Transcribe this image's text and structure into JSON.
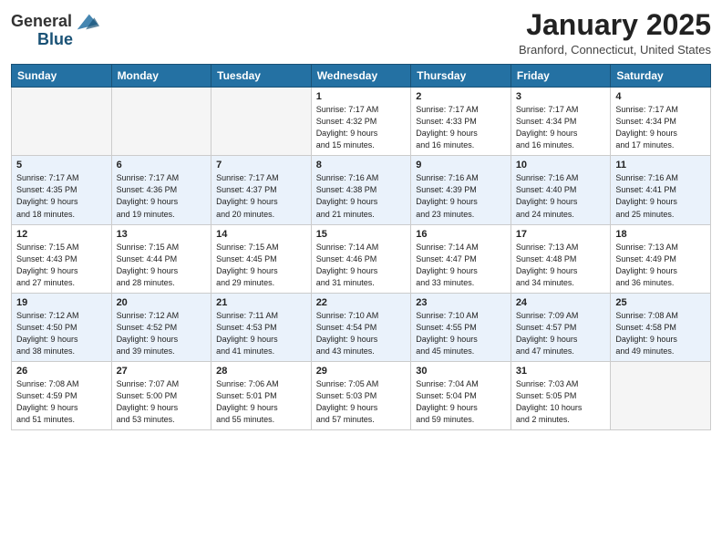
{
  "header": {
    "logo_general": "General",
    "logo_blue": "Blue",
    "month": "January 2025",
    "location": "Branford, Connecticut, United States"
  },
  "days_of_week": [
    "Sunday",
    "Monday",
    "Tuesday",
    "Wednesday",
    "Thursday",
    "Friday",
    "Saturday"
  ],
  "weeks": [
    {
      "days": [
        {
          "num": "",
          "info": ""
        },
        {
          "num": "",
          "info": ""
        },
        {
          "num": "",
          "info": ""
        },
        {
          "num": "1",
          "info": "Sunrise: 7:17 AM\nSunset: 4:32 PM\nDaylight: 9 hours\nand 15 minutes."
        },
        {
          "num": "2",
          "info": "Sunrise: 7:17 AM\nSunset: 4:33 PM\nDaylight: 9 hours\nand 16 minutes."
        },
        {
          "num": "3",
          "info": "Sunrise: 7:17 AM\nSunset: 4:34 PM\nDaylight: 9 hours\nand 16 minutes."
        },
        {
          "num": "4",
          "info": "Sunrise: 7:17 AM\nSunset: 4:34 PM\nDaylight: 9 hours\nand 17 minutes."
        }
      ]
    },
    {
      "days": [
        {
          "num": "5",
          "info": "Sunrise: 7:17 AM\nSunset: 4:35 PM\nDaylight: 9 hours\nand 18 minutes."
        },
        {
          "num": "6",
          "info": "Sunrise: 7:17 AM\nSunset: 4:36 PM\nDaylight: 9 hours\nand 19 minutes."
        },
        {
          "num": "7",
          "info": "Sunrise: 7:17 AM\nSunset: 4:37 PM\nDaylight: 9 hours\nand 20 minutes."
        },
        {
          "num": "8",
          "info": "Sunrise: 7:16 AM\nSunset: 4:38 PM\nDaylight: 9 hours\nand 21 minutes."
        },
        {
          "num": "9",
          "info": "Sunrise: 7:16 AM\nSunset: 4:39 PM\nDaylight: 9 hours\nand 23 minutes."
        },
        {
          "num": "10",
          "info": "Sunrise: 7:16 AM\nSunset: 4:40 PM\nDaylight: 9 hours\nand 24 minutes."
        },
        {
          "num": "11",
          "info": "Sunrise: 7:16 AM\nSunset: 4:41 PM\nDaylight: 9 hours\nand 25 minutes."
        }
      ]
    },
    {
      "days": [
        {
          "num": "12",
          "info": "Sunrise: 7:15 AM\nSunset: 4:43 PM\nDaylight: 9 hours\nand 27 minutes."
        },
        {
          "num": "13",
          "info": "Sunrise: 7:15 AM\nSunset: 4:44 PM\nDaylight: 9 hours\nand 28 minutes."
        },
        {
          "num": "14",
          "info": "Sunrise: 7:15 AM\nSunset: 4:45 PM\nDaylight: 9 hours\nand 29 minutes."
        },
        {
          "num": "15",
          "info": "Sunrise: 7:14 AM\nSunset: 4:46 PM\nDaylight: 9 hours\nand 31 minutes."
        },
        {
          "num": "16",
          "info": "Sunrise: 7:14 AM\nSunset: 4:47 PM\nDaylight: 9 hours\nand 33 minutes."
        },
        {
          "num": "17",
          "info": "Sunrise: 7:13 AM\nSunset: 4:48 PM\nDaylight: 9 hours\nand 34 minutes."
        },
        {
          "num": "18",
          "info": "Sunrise: 7:13 AM\nSunset: 4:49 PM\nDaylight: 9 hours\nand 36 minutes."
        }
      ]
    },
    {
      "days": [
        {
          "num": "19",
          "info": "Sunrise: 7:12 AM\nSunset: 4:50 PM\nDaylight: 9 hours\nand 38 minutes."
        },
        {
          "num": "20",
          "info": "Sunrise: 7:12 AM\nSunset: 4:52 PM\nDaylight: 9 hours\nand 39 minutes."
        },
        {
          "num": "21",
          "info": "Sunrise: 7:11 AM\nSunset: 4:53 PM\nDaylight: 9 hours\nand 41 minutes."
        },
        {
          "num": "22",
          "info": "Sunrise: 7:10 AM\nSunset: 4:54 PM\nDaylight: 9 hours\nand 43 minutes."
        },
        {
          "num": "23",
          "info": "Sunrise: 7:10 AM\nSunset: 4:55 PM\nDaylight: 9 hours\nand 45 minutes."
        },
        {
          "num": "24",
          "info": "Sunrise: 7:09 AM\nSunset: 4:57 PM\nDaylight: 9 hours\nand 47 minutes."
        },
        {
          "num": "25",
          "info": "Sunrise: 7:08 AM\nSunset: 4:58 PM\nDaylight: 9 hours\nand 49 minutes."
        }
      ]
    },
    {
      "days": [
        {
          "num": "26",
          "info": "Sunrise: 7:08 AM\nSunset: 4:59 PM\nDaylight: 9 hours\nand 51 minutes."
        },
        {
          "num": "27",
          "info": "Sunrise: 7:07 AM\nSunset: 5:00 PM\nDaylight: 9 hours\nand 53 minutes."
        },
        {
          "num": "28",
          "info": "Sunrise: 7:06 AM\nSunset: 5:01 PM\nDaylight: 9 hours\nand 55 minutes."
        },
        {
          "num": "29",
          "info": "Sunrise: 7:05 AM\nSunset: 5:03 PM\nDaylight: 9 hours\nand 57 minutes."
        },
        {
          "num": "30",
          "info": "Sunrise: 7:04 AM\nSunset: 5:04 PM\nDaylight: 9 hours\nand 59 minutes."
        },
        {
          "num": "31",
          "info": "Sunrise: 7:03 AM\nSunset: 5:05 PM\nDaylight: 10 hours\nand 2 minutes."
        },
        {
          "num": "",
          "info": ""
        }
      ]
    }
  ]
}
